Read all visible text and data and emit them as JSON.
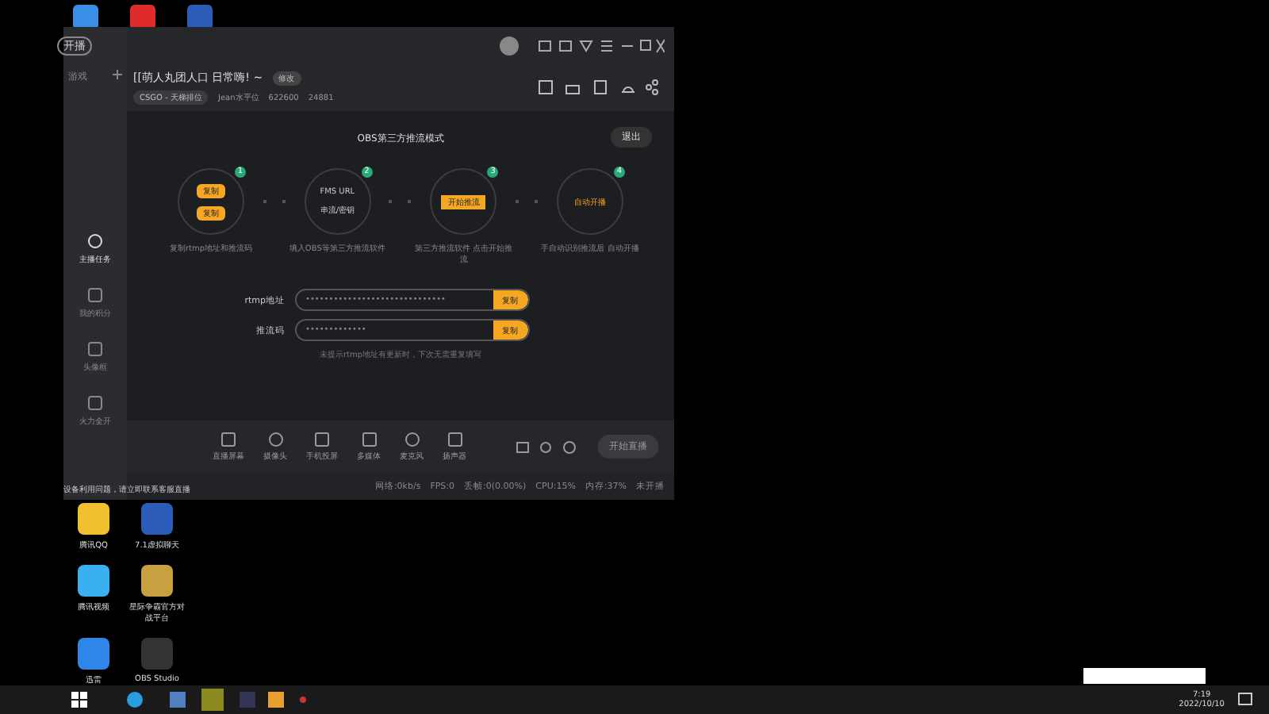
{
  "top_icons": [
    {
      "kind": "monitor"
    },
    {
      "kind": "music"
    },
    {
      "kind": "app"
    }
  ],
  "window": {
    "mode_pill": "开播",
    "sidebar_title": "游戏",
    "sidebar_items": [
      {
        "label": "主播任务",
        "selected": true
      },
      {
        "label": "我的积分",
        "selected": false
      },
      {
        "label": "头像框",
        "selected": false
      },
      {
        "label": "火力全开",
        "selected": false
      }
    ],
    "room_title": "[[萌人丸团人口 日常嗨! ~",
    "edit_tag": "修改",
    "category": "CSGO - 天梯排位",
    "host": "Jean水平位",
    "room_id": "622600",
    "heat": "24881",
    "obs_title": "OBS第三方推流模式",
    "exit": "退出",
    "steps": [
      {
        "number": "1",
        "kind": "copy",
        "buttons": [
          "复制",
          "复制"
        ],
        "caption": "复制rtmp地址和推流码"
      },
      {
        "number": "2",
        "kind": "fields",
        "lines": [
          "FMS URL",
          "串流/密钥"
        ],
        "caption": "填入OBS等第三方推流软件"
      },
      {
        "number": "3",
        "kind": "button",
        "buttons": [
          "开始推流"
        ],
        "caption": "第三方推流软件 点击开始推流"
      },
      {
        "number": "4",
        "kind": "text",
        "lines": [
          "自动开播"
        ],
        "caption": "手自动识别推流后 自动开播"
      }
    ],
    "fields": [
      {
        "label": "rtmp地址",
        "value": "••••••••••••••••••••••••••••••",
        "button": "复制"
      },
      {
        "label": "推流码",
        "value": "•••••••••••••",
        "button": "复制"
      }
    ],
    "hint": "未提示rtmp地址有更新时，下次无需重复填写",
    "tools": [
      {
        "kind": "screen",
        "label": "直播屏幕"
      },
      {
        "kind": "camera",
        "label": "摄像头"
      },
      {
        "kind": "phone",
        "label": "手机投屏"
      },
      {
        "kind": "media",
        "label": "多媒体"
      },
      {
        "kind": "mic",
        "label": "麦克风"
      },
      {
        "kind": "speaker",
        "label": "扬声器"
      }
    ],
    "start": "开始直播",
    "notice": "设备利用问题，请立即联系客服直播",
    "status": [
      "网络:0kb/s",
      "FPS:0",
      "丢帧:0(0.00%)",
      "CPU:15%",
      "内存:37%",
      "未开播"
    ]
  },
  "desktop_icons": [
    {
      "kind": "qq",
      "label": "腾讯QQ"
    },
    {
      "kind": "app",
      "label": "7.1虚拟聊天"
    },
    {
      "kind": "video",
      "label": "腾讯视频"
    },
    {
      "kind": "game",
      "label": "星际争霸官方对战平台"
    },
    {
      "kind": "bird",
      "label": "迅雷"
    },
    {
      "kind": "obs",
      "label": "OBS Studio"
    }
  ],
  "tray": {
    "time": "7:19",
    "date": "2022/10/10"
  }
}
